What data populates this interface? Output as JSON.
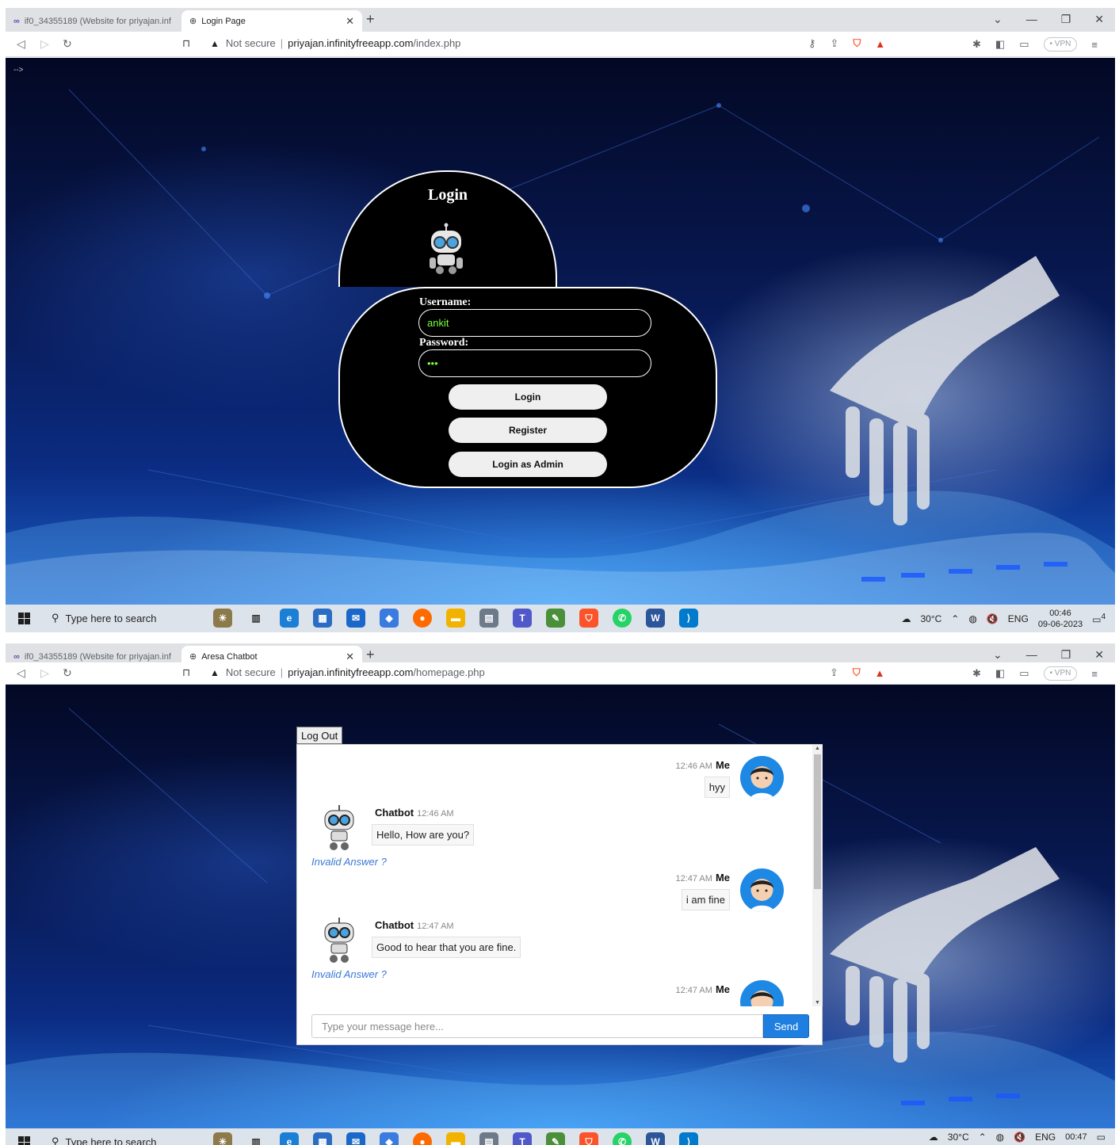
{
  "screen1": {
    "tabs": [
      {
        "label": "if0_34355189 (Website for priyajan.inf"
      },
      {
        "label": "Login Page"
      }
    ],
    "url": {
      "warning": "Not secure",
      "host": "priyajan.infinityfreeapp.com",
      "path": "/index.php"
    },
    "vpn_label": "VPN",
    "page_corner_text": "-->",
    "login": {
      "title": "Login",
      "username_label": "Username:",
      "username_value": "ankit",
      "password_label": "Password:",
      "password_value": "•••",
      "buttons": {
        "login": "Login",
        "register": "Register",
        "admin": "Login as Admin"
      }
    },
    "taskbar": {
      "search_placeholder": "Type here to search",
      "weather": "30°C",
      "lang": "ENG",
      "time": "00:46",
      "date": "09-06-2023",
      "notifications": "4"
    }
  },
  "screen2": {
    "tabs": [
      {
        "label": "if0_34355189 (Website for priyajan.inf"
      },
      {
        "label": "Aresa Chatbot"
      }
    ],
    "url": {
      "warning": "Not secure",
      "host": "priyajan.infinityfreeapp.com",
      "path": "/homepage.php"
    },
    "vpn_label": "VPN",
    "logout_label": "Log Out",
    "chat": {
      "me_name": "Me",
      "bot_name": "Chatbot",
      "invalid_label": "Invalid Answer ?",
      "messages": [
        {
          "from": "me",
          "time": "12:46 AM",
          "text": "hyy"
        },
        {
          "from": "bot",
          "time": "12:46 AM",
          "text": "Hello, How are you?"
        },
        {
          "from": "me",
          "time": "12:47 AM",
          "text": "i am fine"
        },
        {
          "from": "bot",
          "time": "12:47 AM",
          "text": "Good to hear that you are fine."
        },
        {
          "from": "me",
          "time": "12:47 AM",
          "text": ""
        }
      ],
      "input_placeholder": "Type your message here...",
      "send_label": "Send"
    },
    "taskbar": {
      "search_placeholder": "Type here to search",
      "weather": "30°C",
      "lang": "ENG",
      "time": "00:47"
    }
  }
}
